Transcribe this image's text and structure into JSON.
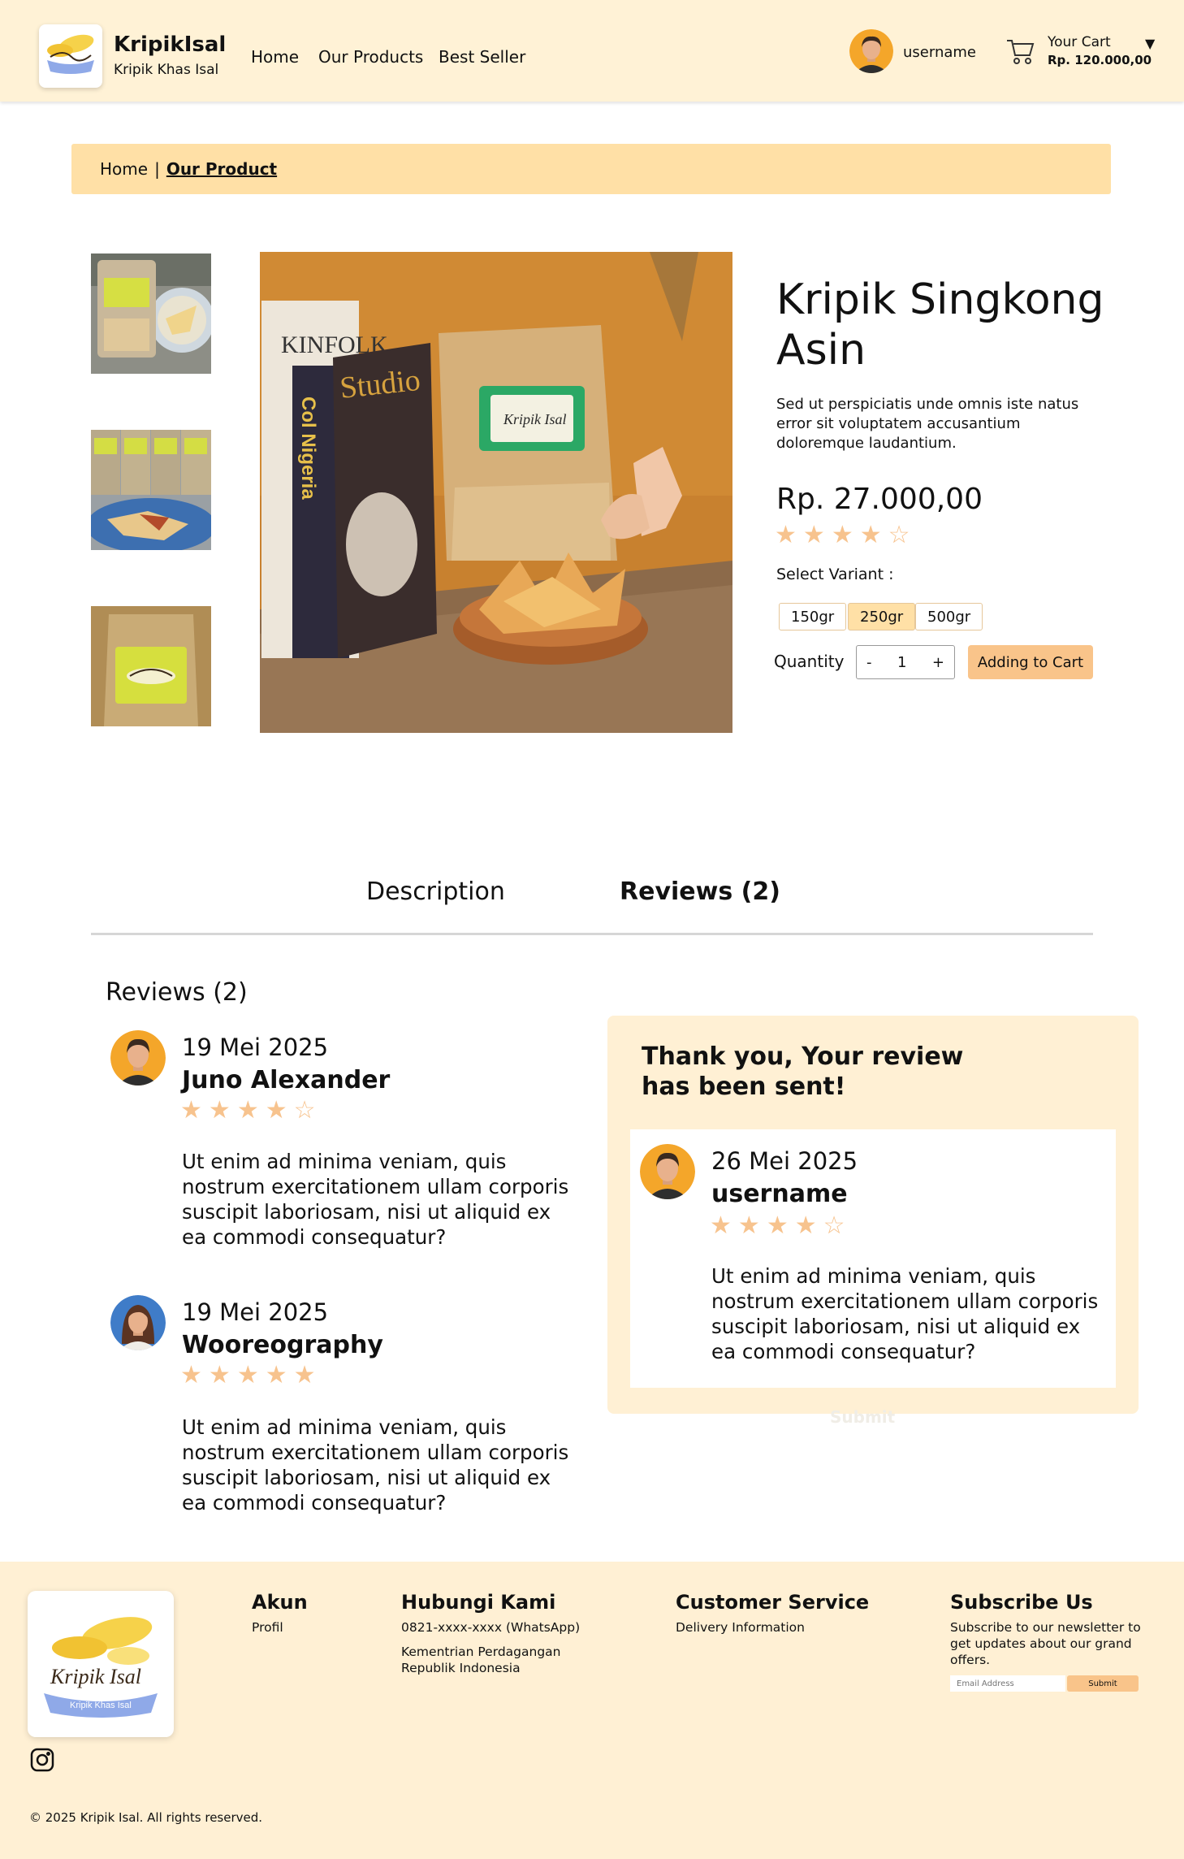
{
  "header": {
    "brand_name": "KripikIsal",
    "brand_sub": "Kripik Khas Isal",
    "nav": [
      "Home",
      "Our Products",
      "Best Seller"
    ],
    "username": "username",
    "cart_label": "Your Cart",
    "cart_total": "Rp. 120.000,00",
    "cart_caret": "▼"
  },
  "breadcrumb": {
    "home": "Home",
    "separator": "|",
    "current": "Our Product"
  },
  "product": {
    "title": "Kripik Singkong Asin",
    "description": "Sed ut perspiciatis unde omnis iste natus error sit voluptatem  accusantium doloremque laudantium.",
    "price": "Rp. 27.000,00",
    "rating": 4,
    "variant_label": "Select Variant :",
    "variants": [
      "150gr",
      "250gr",
      "500gr"
    ],
    "selected_variant": "250gr",
    "quantity_label": "Quantity",
    "quantity": "1",
    "minus": "-",
    "plus": "+",
    "add_to_cart": "Adding to Cart",
    "main_image_text": {
      "book1": "KINFOLK",
      "book2": "Col Nigeria",
      "book3": "Studio",
      "label": "Kripik Isal"
    }
  },
  "tabs": [
    "Description",
    "Reviews (2)"
  ],
  "active_tab": "Reviews (2)",
  "reviews": {
    "heading": "Reviews (2)",
    "items": [
      {
        "date": "19 Mei 2025",
        "name": "Juno Alexander",
        "rating": 4,
        "text": "Ut enim ad minima veniam, quis nostrum exercitationem ullam corporis  suscipit laboriosam, nisi ut aliquid ex ea commodi consequatur?"
      },
      {
        "date": "19 Mei 2025",
        "name": "Wooreography",
        "rating": 5,
        "text": "Ut enim ad minima veniam, quis nostrum exercitationem ullam corporis  suscipit laboriosam, nisi ut aliquid ex ea commodi consequatur?"
      }
    ]
  },
  "thanks": {
    "title": "Thank you, Your review has been sent!",
    "review": {
      "date": "26 Mei 2025",
      "name": "username",
      "rating": 4,
      "text": "Ut enim ad minima veniam, quis nostrum exercitationem ullam corporis  suscipit laboriosam, nisi ut aliquid ex ea commodi consequatur?"
    },
    "ghost_submit": "Submit"
  },
  "footer": {
    "akun_title": "Akun",
    "akun_items": [
      "Profil"
    ],
    "contact_title": "Hubungi Kami",
    "contact_phone": "0821-xxxx-xxxx (WhatsApp)",
    "contact_org": "Kementrian Perdagangan Republik Indonesia",
    "cs_title": "Customer Service",
    "cs_items": [
      "Delivery Information"
    ],
    "subscribe_title": "Subscribe Us",
    "subscribe_text": "Subscribe to our newsletter to get updates about our grand offers.",
    "email_placeholder": "Email Address",
    "submit": "Submit",
    "logo_text": "Kripik Isal",
    "logo_ribbon": "Kripik Khas Isal",
    "copyright": "© 2025 Kripik Isal. All rights reserved."
  },
  "colors": {
    "header_bg": "#FFF2D6",
    "breadcrumb_bg": "#FFE0A6",
    "accent": "#F9C48A",
    "star": "#F7C38E",
    "footer_bg": "#FFF0D4"
  },
  "icons": [
    "cart-icon",
    "instagram-icon",
    "star-icon",
    "caret-down-icon"
  ]
}
